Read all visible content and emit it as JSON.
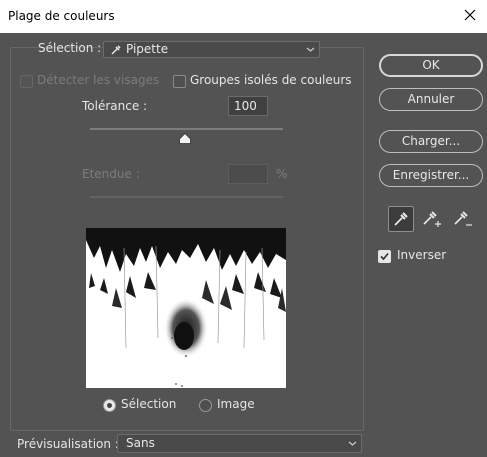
{
  "window": {
    "title": "Plage de couleurs"
  },
  "selection": {
    "label": "Sélection :",
    "value": "Pipette"
  },
  "options": {
    "detect_faces": "Détecter les visages",
    "localized_clusters": "Groupes isolés de couleurs"
  },
  "tolerance": {
    "label": "Tolérance :",
    "value": "100"
  },
  "range": {
    "label": "Etendue :",
    "value": "",
    "unit": "%"
  },
  "buttons": {
    "ok": "OK",
    "cancel": "Annuler",
    "load": "Charger...",
    "save": "Enregistrer..."
  },
  "tools": [
    "eyedropper-icon",
    "eyedropper-add-icon",
    "eyedropper-subtract-icon"
  ],
  "invert": {
    "label": "Inverser",
    "checked": true
  },
  "preview_mode": {
    "selection": "Sélection",
    "image": "Image",
    "selected": "selection"
  },
  "preview_option": {
    "label": "Prévisualisation :",
    "value": "Sans"
  }
}
